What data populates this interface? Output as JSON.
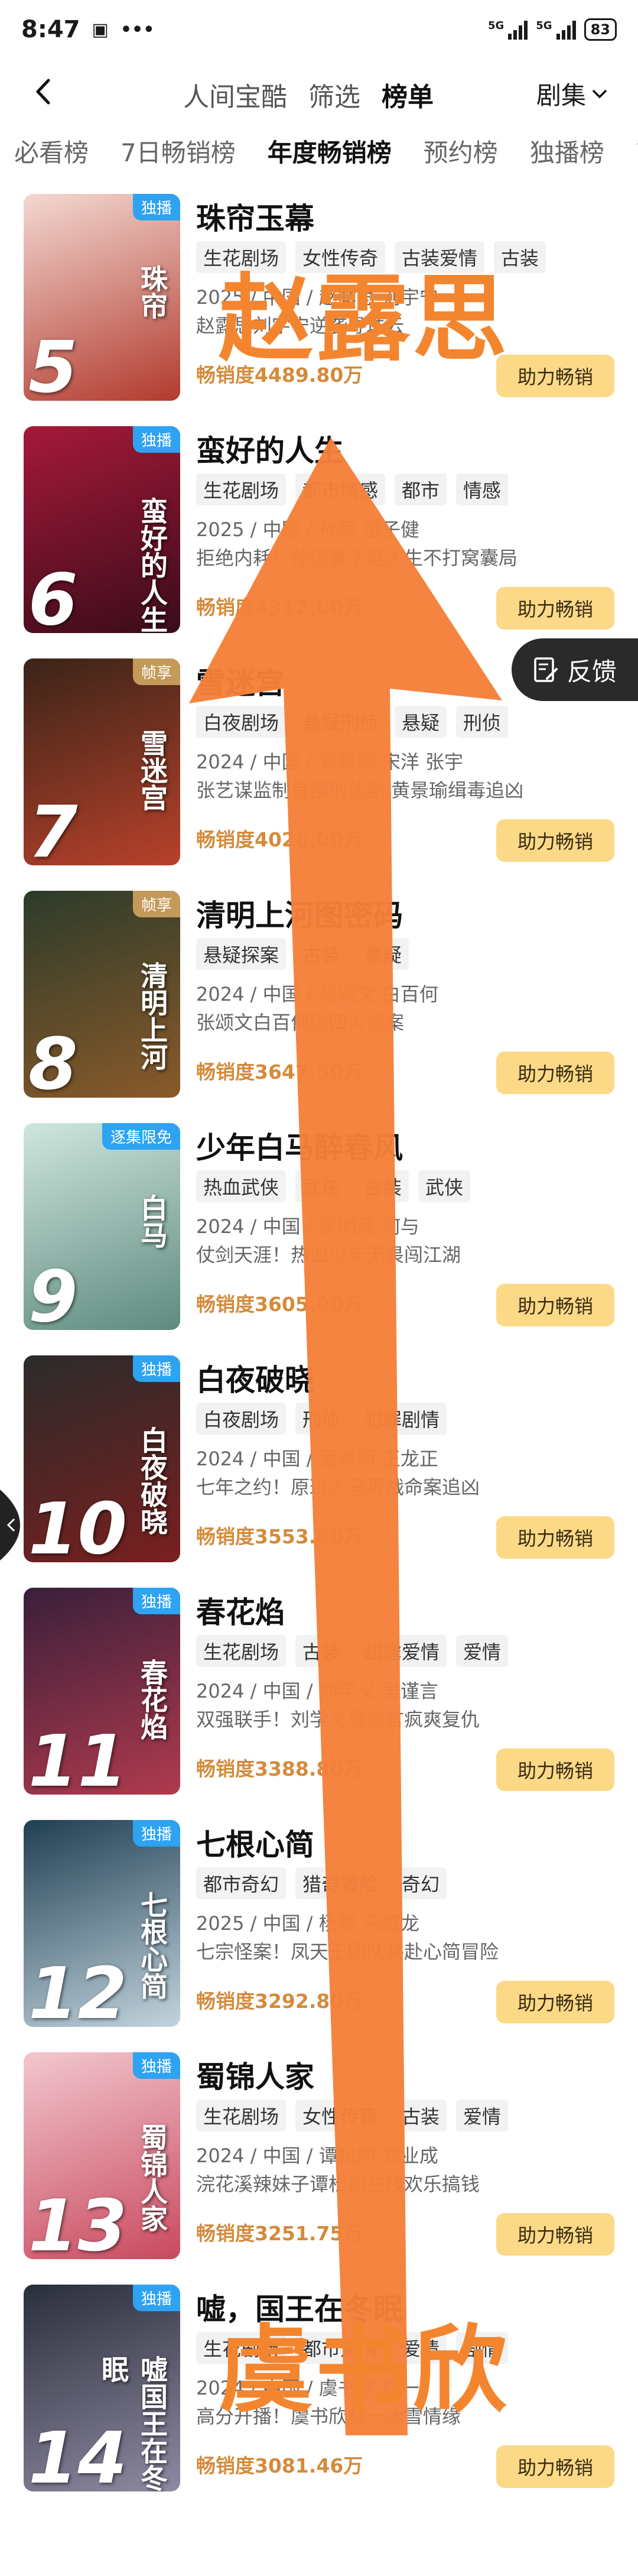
{
  "status": {
    "time": "8:47",
    "battery": "83",
    "net1": "5G",
    "net2": "5G"
  },
  "header": {
    "back_label": "‹",
    "tabs": [
      "人间宝酷",
      "筛选",
      "榜单"
    ],
    "active_tab": 2,
    "dropdown": "剧集"
  },
  "sub_tabs": [
    "必看榜",
    "7日畅销榜",
    "年度畅销榜",
    "预约榜",
    "独播榜",
    "高"
  ],
  "feedback": "反馈",
  "overlay": {
    "top_name": "赵露思",
    "bottom_name": "虞书欣"
  },
  "items": [
    {
      "rank": "5",
      "title": "珠帘玉幕",
      "badge": "独播",
      "badge_color": "blue",
      "poster_text": "珠帘",
      "tags": [
        "生花剧场",
        "女性传奇",
        "古装爱情",
        "古装"
      ],
      "meta": "2025 / 中国 / 赵露思 刘宇宁",
      "desc": "赵露思刘宇宁逆袭寻珠云",
      "sales": "畅销度4489.80万",
      "button": "助力畅销",
      "poster_color": [
        "#f3d9d2",
        "#b23a2e"
      ]
    },
    {
      "rank": "6",
      "title": "蛮好的人生",
      "badge": "独播",
      "badge_color": "blue",
      "poster_text": "蛮好的人生",
      "tags": [
        "生花剧场",
        "都市情感",
        "都市",
        "情感"
      ],
      "meta": "2025 / 中国 / 孙俪 董子健",
      "desc": "拒绝内耗！孙俪董子健人生不打窝囊局",
      "sales": "畅销度4312.00万",
      "button": "助力畅销",
      "poster_color": [
        "#a6193a",
        "#3a0c1a"
      ]
    },
    {
      "rank": "7",
      "title": "雪迷宫",
      "badge": "帧享",
      "badge_color": "gold",
      "poster_text": "雪迷宫",
      "tags": [
        "白夜剧场",
        "悬疑刑侦",
        "悬疑",
        "刑侦"
      ],
      "meta": "2024 / 中国 / 黄景瑜 宋洋 张宇",
      "desc": "张艺谋监制首部刑侦剧 黄景瑜缉毒追凶",
      "sales": "畅销度4026.00万",
      "button": "助力畅销",
      "poster_color": [
        "#3a2418",
        "#b8412b"
      ]
    },
    {
      "rank": "8",
      "title": "清明上河图密码",
      "badge": "帧享",
      "badge_color": "gold",
      "poster_text": "清明上河",
      "tags": [
        "悬疑探案",
        "古装",
        "悬疑"
      ],
      "meta": "2024 / 中国 / 张颂文 白百何",
      "desc": "张颂文白百何破四大诡案",
      "sales": "畅销度3647.50万",
      "button": "助力畅销",
      "poster_color": [
        "#2c3b2a",
        "#8a5a2a"
      ]
    },
    {
      "rank": "9",
      "title": "少年白马醉春风",
      "badge": "逐集限免",
      "badge_color": "blue",
      "poster_text": "白马",
      "tags": [
        "热血武侠",
        "武侠",
        "古装",
        "武侠"
      ],
      "meta": "2024 / 中国 / 侯明昊 何与",
      "desc": "仗剑天涯！热血少年无畏闯江湖",
      "sales": "畅销度3605.00万",
      "button": "助力畅销",
      "poster_color": [
        "#cfe6df",
        "#5e8a7e"
      ]
    },
    {
      "rank": "10",
      "title": "白夜破晓",
      "badge": "独播",
      "badge_color": "blue",
      "poster_text": "白夜破晓",
      "tags": [
        "白夜剧场",
        "刑侦",
        "犯罪剧情"
      ],
      "meta": "2024 / 中国 / 潘粤明 王龙正",
      "desc": "七年之约！原班人马再战命案追凶",
      "sales": "畅销度3553.80万",
      "button": "助力畅销",
      "poster_color": [
        "#2b2b2b",
        "#7a1f1f"
      ]
    },
    {
      "rank": "11",
      "title": "春花焰",
      "badge": "独播",
      "badge_color": "blue",
      "poster_text": "春花焰",
      "tags": [
        "生花剧场",
        "古装",
        "甜虐爱情",
        "爱情"
      ],
      "meta": "2024 / 中国 / 刘学义 吴谨言",
      "desc": "双强联手！刘学义吴谨言疯爽复仇",
      "sales": "畅销度3388.80万",
      "button": "助力畅销",
      "poster_color": [
        "#3a1f3a",
        "#b03a4e"
      ]
    },
    {
      "rank": "12",
      "title": "七根心简",
      "badge": "独播",
      "badge_color": "blue",
      "poster_text": "七根心简",
      "tags": [
        "都市奇幻",
        "猎奇冒险",
        "奇幻"
      ],
      "meta": "2025 / 中国 / 杨幂 宋威龙",
      "desc": "七宗怪案！凤天王团队共赴心简冒险",
      "sales": "畅销度3292.80万",
      "button": "助力畅销",
      "poster_color": [
        "#1f3f52",
        "#c2d4de"
      ]
    },
    {
      "rank": "13",
      "title": "蜀锦人家",
      "badge": "独播",
      "badge_color": "blue",
      "poster_text": "蜀锦人家",
      "tags": [
        "生花剧场",
        "女性传奇",
        "古装",
        "爱情"
      ],
      "meta": "2024 / 中国 / 谭松韵 郑业成",
      "desc": "浣花溪辣妹子谭松韵在线欢乐搞钱",
      "sales": "畅销度3251.75万",
      "button": "助力畅销",
      "poster_color": [
        "#f2c7cf",
        "#c9495e"
      ]
    },
    {
      "rank": "14",
      "title": "嘘，国王在冬眠",
      "badge": "独播",
      "badge_color": "blue",
      "poster_text": "嘘国王在冬眠",
      "tags": [
        "生花剧场",
        "都市爱情",
        "爱情",
        "剧情"
      ],
      "meta": "2024 / 中国 / 虞书欣 林一",
      "desc": "高分开播！虞书欣林一冰雪情缘",
      "sales": "畅销度3081.46万",
      "button": "助力畅销",
      "poster_color": [
        "#2a2e3a",
        "#8f8aa3"
      ]
    }
  ]
}
